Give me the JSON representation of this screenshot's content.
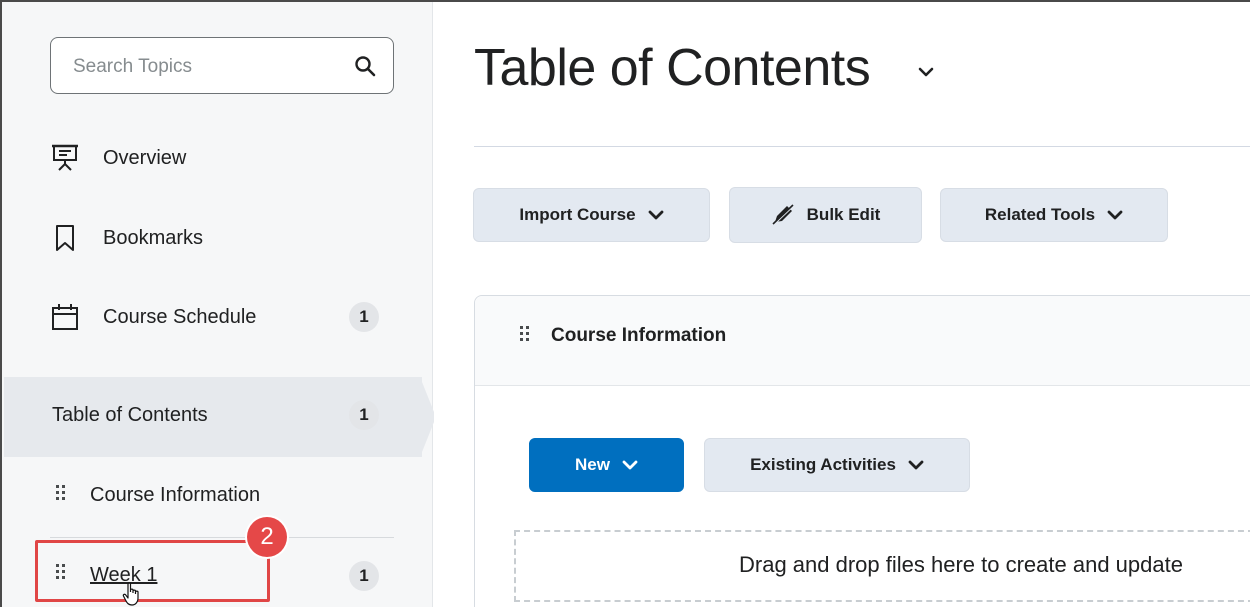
{
  "sidebar": {
    "search": {
      "placeholder": "Search Topics"
    },
    "items": [
      {
        "label": "Overview",
        "icon": "presentation-icon"
      },
      {
        "label": "Bookmarks",
        "icon": "bookmark-icon"
      },
      {
        "label": "Course Schedule",
        "icon": "calendar-icon",
        "badge": "1"
      }
    ],
    "toc": {
      "label": "Table of Contents",
      "badge": "1"
    },
    "modules": [
      {
        "label": "Course Information"
      },
      {
        "label": "Week 1",
        "badge": "1"
      }
    ],
    "step_marker": "2"
  },
  "main": {
    "title": "Table of Contents",
    "toolbar": {
      "import_label": "Import Course",
      "bulk_edit_label": "Bulk Edit",
      "related_tools_label": "Related Tools"
    },
    "module": {
      "title": "Course Information",
      "new_label": "New",
      "existing_label": "Existing Activities",
      "dropzone_text": "Drag and drop files here to create and update"
    }
  },
  "colors": {
    "primary": "#006fbf",
    "highlight": "#e04646",
    "link": "#1b4e82"
  }
}
